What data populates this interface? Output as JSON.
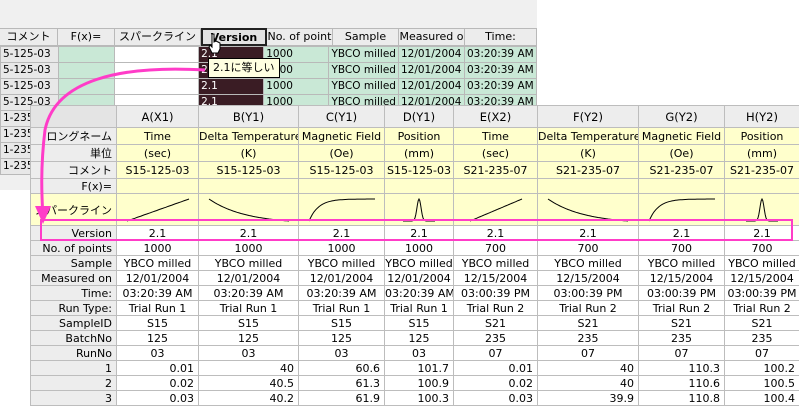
{
  "background_sheet": {
    "headers": [
      "コメント",
      "F(x)=",
      "スパークライン",
      "Version",
      "No. of point",
      "Sample",
      "Measured o",
      "Time:"
    ],
    "rows": [
      {
        "label": "5-125-03",
        "cells": [
          "",
          "",
          "",
          "2.1",
          "1000",
          "YBCO milled",
          "12/01/2004",
          "03:20:39 AM"
        ]
      },
      {
        "label": "5-125-03",
        "cells": [
          "",
          "",
          "",
          "2.1",
          "1000",
          "YBCO milled",
          "12/01/2004",
          "03:20:39 AM"
        ]
      },
      {
        "label": "5-125-03",
        "cells": [
          "",
          "",
          "",
          "2.1",
          "1000",
          "YBCO milled",
          "12/01/2004",
          "03:20:39 AM"
        ]
      },
      {
        "label": "5-125-03",
        "cells": [
          "",
          "",
          "",
          "2.1",
          "1000",
          "YBCO milled",
          "12/01/2004",
          "03:20:39 AM"
        ]
      },
      {
        "label": "1-235-",
        "cells": [
          "",
          "",
          "",
          "",
          "",
          "",
          "",
          ""
        ]
      },
      {
        "label": "1-235-",
        "cells": [
          "",
          "",
          "",
          "",
          "",
          "",
          "",
          ""
        ]
      },
      {
        "label": "1-235-",
        "cells": [
          "",
          "",
          "",
          "",
          "",
          "",
          "",
          ""
        ]
      },
      {
        "label": "1-235-",
        "cells": [
          "",
          "",
          "",
          "",
          "",
          "",
          "",
          ""
        ]
      }
    ],
    "tooltip": "2.1に等しい"
  },
  "front_sheet": {
    "columns": [
      "A(X1)",
      "B(Y1)",
      "C(Y1)",
      "D(Y1)",
      "E(X2)",
      "F(Y2)",
      "G(Y2)",
      "H(Y2)"
    ],
    "meta_rows": [
      {
        "label": "ロングネーム",
        "values": [
          "Time",
          "Delta Temperature",
          "Magnetic Field",
          "Position",
          "Time",
          "Delta Temperature",
          "Magnetic Field",
          "Position"
        ]
      },
      {
        "label": "単位",
        "values": [
          "(sec)",
          "(K)",
          "(Oe)",
          "(mm)",
          "(sec)",
          "(K)",
          "(Oe)",
          "(mm)"
        ]
      },
      {
        "label": "コメント",
        "values": [
          "S15-125-03",
          "S15-125-03",
          "S15-125-03",
          "S15-125-03",
          "S21-235-07",
          "S21-235-07",
          "S21-235-07",
          "S21-235-07"
        ]
      },
      {
        "label": "F(x)=",
        "values": [
          "",
          "",
          "",
          "",
          "",
          "",
          "",
          ""
        ]
      }
    ],
    "sparkline_row_label": "スパークライン",
    "sparklines": [
      "rise",
      "decay",
      "saturate",
      "peak",
      "rise",
      "decay",
      "saturate",
      "peak"
    ],
    "attr_rows": [
      {
        "label": "Version",
        "values": [
          "2.1",
          "2.1",
          "2.1",
          "2.1",
          "2.1",
          "2.1",
          "2.1",
          "2.1"
        ],
        "selected": true
      },
      {
        "label": "No. of points",
        "values": [
          "1000",
          "1000",
          "1000",
          "1000",
          "700",
          "700",
          "700",
          "700"
        ]
      },
      {
        "label": "Sample",
        "values": [
          "YBCO milled",
          "YBCO milled",
          "YBCO milled",
          "YBCO milled",
          "YBCO milled",
          "YBCO milled",
          "YBCO milled",
          "YBCO milled"
        ]
      },
      {
        "label": "Measured on",
        "values": [
          "12/01/2004",
          "12/01/2004",
          "12/01/2004",
          "12/01/2004",
          "12/15/2004",
          "12/15/2004",
          "12/15/2004",
          "12/15/2004"
        ]
      },
      {
        "label": "Time:",
        "values": [
          "03:20:39 AM",
          "03:20:39 AM",
          "03:20:39 AM",
          "03:20:39 AM",
          "03:00:39 PM",
          "03:00:39 PM",
          "03:00:39 PM",
          "03:00:39 PM"
        ]
      },
      {
        "label": "Run Type:",
        "values": [
          "Trial Run 1",
          "Trial Run 1",
          "Trial Run 1",
          "Trial Run 1",
          "Trial Run 2",
          "Trial Run 2",
          "Trial Run 2",
          "Trial Run 2"
        ]
      },
      {
        "label": "SampleID",
        "values": [
          "S15",
          "S15",
          "S15",
          "S15",
          "S21",
          "S21",
          "S21",
          "S21"
        ]
      },
      {
        "label": "BatchNo",
        "values": [
          "125",
          "125",
          "125",
          "125",
          "235",
          "235",
          "235",
          "235"
        ]
      },
      {
        "label": "RunNo",
        "values": [
          "03",
          "03",
          "03",
          "03",
          "07",
          "07",
          "07",
          "07"
        ]
      }
    ],
    "data_rows": [
      {
        "label": "1",
        "values": [
          "0.01",
          "40",
          "60.6",
          "101.7",
          "0.01",
          "40",
          "110.3",
          "100.2"
        ]
      },
      {
        "label": "2",
        "values": [
          "0.02",
          "40.5",
          "61.3",
          "100.9",
          "0.02",
          "40",
          "110.6",
          "100.5"
        ]
      },
      {
        "label": "3",
        "values": [
          "0.03",
          "40.2",
          "61.9",
          "100.3",
          "0.03",
          "39.9",
          "110.8",
          "100.4"
        ]
      }
    ]
  },
  "colors": {
    "highlight": "#ff3cc8",
    "meta_background": "#ffffcc",
    "background_row": "#c9e8d6",
    "selected_cell": "#3a1c24"
  }
}
